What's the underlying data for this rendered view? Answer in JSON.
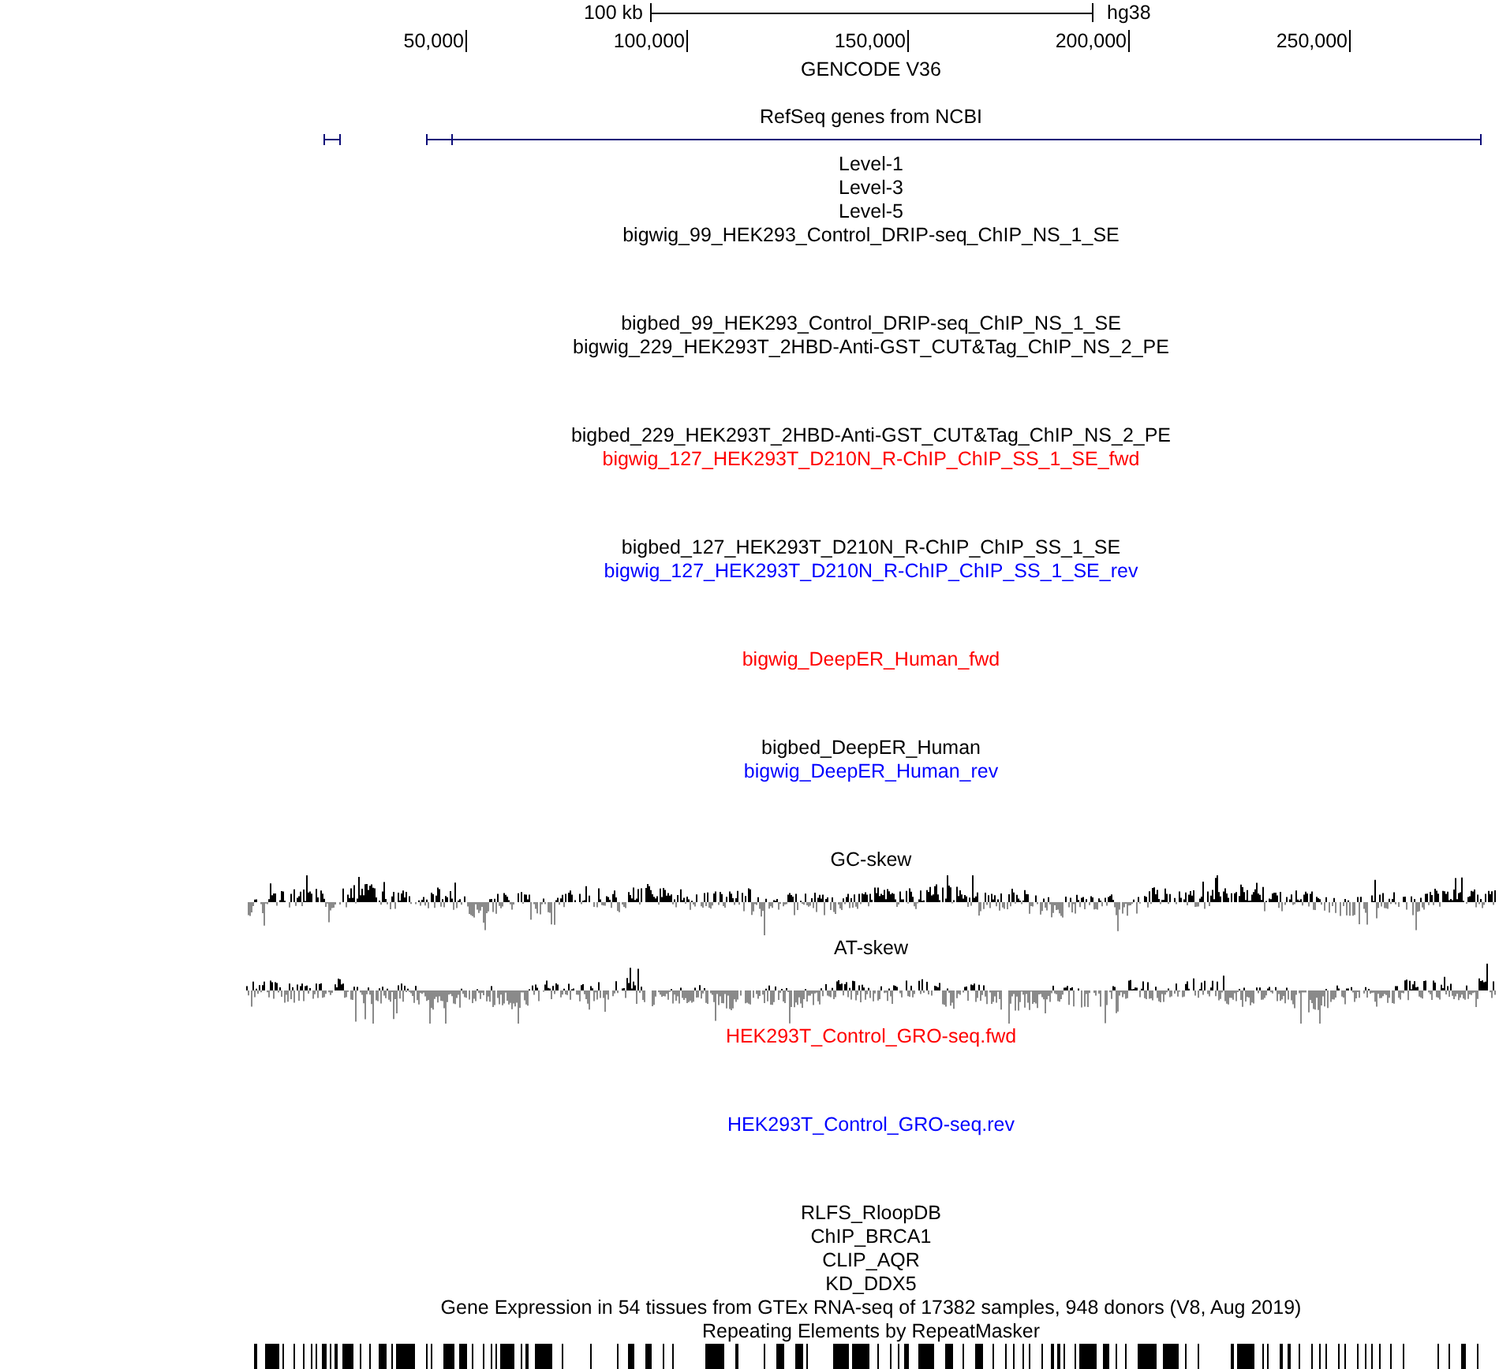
{
  "ruler": {
    "scale_label": "100 kb",
    "assembly": "hg38",
    "ticks": [
      "50,000",
      "100,000",
      "150,000",
      "200,000",
      "250,000"
    ]
  },
  "tracks": [
    {
      "label": "GENCODE V36",
      "kind": "annotation",
      "color": "#000000"
    },
    {
      "label": "RefSeq genes from NCBI",
      "kind": "genes",
      "color": "#000000"
    },
    {
      "label": "Level-1",
      "kind": "compact",
      "color": "#000000"
    },
    {
      "label": "Level-3",
      "kind": "compact",
      "color": "#000000"
    },
    {
      "label": "Level-5",
      "kind": "compact",
      "color": "#000000"
    },
    {
      "label": "bigwig_99_HEK293_Control_DRIP-seq_ChIP_NS_1_SE",
      "kind": "signal",
      "color": "#000000"
    },
    {
      "label": "bigbed_99_HEK293_Control_DRIP-seq_ChIP_NS_1_SE",
      "kind": "compact",
      "color": "#000000"
    },
    {
      "label": "bigwig_229_HEK293T_2HBD-Anti-GST_CUT&Tag_ChIP_NS_2_PE",
      "kind": "signal",
      "color": "#000000"
    },
    {
      "label": "bigbed_229_HEK293T_2HBD-Anti-GST_CUT&Tag_ChIP_NS_2_PE",
      "kind": "compact",
      "color": "#000000"
    },
    {
      "label": "bigwig_127_HEK293T_D210N_R-ChIP_ChIP_SS_1_SE_fwd",
      "kind": "signal",
      "color": "#ff0000"
    },
    {
      "label": "bigbed_127_HEK293T_D210N_R-ChIP_ChIP_SS_1_SE",
      "kind": "compact",
      "color": "#000000"
    },
    {
      "label": "bigwig_127_HEK293T_D210N_R-ChIP_ChIP_SS_1_SE_rev",
      "kind": "signal",
      "color": "#0000ff"
    },
    {
      "label": "bigwig_DeepER_Human_fwd",
      "kind": "signal",
      "color": "#ff0000"
    },
    {
      "label": "bigbed_DeepER_Human",
      "kind": "compact",
      "color": "#000000"
    },
    {
      "label": "bigwig_DeepER_Human_rev",
      "kind": "signal",
      "color": "#0000ff"
    },
    {
      "label": "GC-skew",
      "kind": "skew",
      "color": "#000000"
    },
    {
      "label": "AT-skew",
      "kind": "skew",
      "color": "#000000"
    },
    {
      "label": "HEK293T_Control_GRO-seq.fwd",
      "kind": "signal",
      "color": "#ff0000"
    },
    {
      "label": "HEK293T_Control_GRO-seq.rev",
      "kind": "signal",
      "color": "#0000ff"
    },
    {
      "label": "RLFS_RloopDB",
      "kind": "compact",
      "color": "#000000"
    },
    {
      "label": "ChIP_BRCA1",
      "kind": "compact",
      "color": "#000000"
    },
    {
      "label": "CLIP_AQR",
      "kind": "compact",
      "color": "#000000"
    },
    {
      "label": "KD_DDX5",
      "kind": "compact",
      "color": "#000000"
    },
    {
      "label": "Gene Expression in 54 tissues from GTEx RNA-seq of 17382 samples, 948 donors (V8, Aug 2019)",
      "kind": "compact",
      "color": "#000000"
    },
    {
      "label": "Repeating Elements by RepeatMasker",
      "kind": "repeats",
      "color": "#000000"
    }
  ]
}
